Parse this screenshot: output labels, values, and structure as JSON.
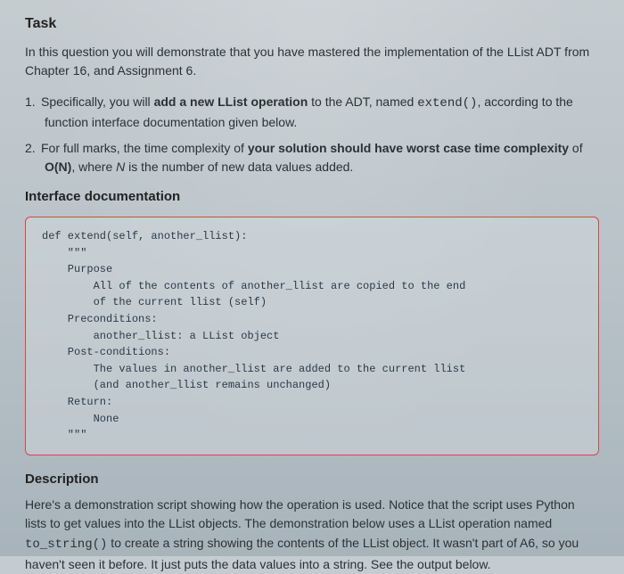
{
  "task_heading": "Task",
  "intro": "In this question you will demonstrate that you have mastered the implementation of the LList ADT from Chapter 16, and Assignment 6.",
  "list": {
    "item1": {
      "num": "1.",
      "pre": "Specifically, you will ",
      "bold": "add a new LList operation",
      "mid": " to the ADT, named ",
      "code": "extend()",
      "post": ", according to the function interface documentation given below."
    },
    "item2": {
      "num": "2.",
      "pre": "For full marks, the time complexity of ",
      "bold": "your solution should have worst case time complexity",
      "mid": " of ",
      "on": "O(N)",
      "post": ", where ",
      "nvar": "N",
      "tail": " is the number of new data values added."
    }
  },
  "interface_heading": "Interface documentation",
  "code": {
    "l1": "def extend(self, another_llist):",
    "l2": "    \"\"\"",
    "l3": "    Purpose",
    "l4": "        All of the contents of another_llist are copied to the end",
    "l5": "        of the current llist (self)",
    "l6": "    Preconditions:",
    "l7": "        another_llist: a LList object",
    "l8": "    Post-conditions:",
    "l9": "        The values in another_llist are added to the current llist",
    "l10": "        (and another_llist remains unchanged)",
    "l11": "    Return:",
    "l12": "        None",
    "l13": "    \"\"\""
  },
  "desc_heading": "Description",
  "desc": {
    "p1a": "Here's a demonstration script showing how the operation is used. Notice that the script uses Python lists to get values into the LList objects. The demonstration below uses a LList operation named ",
    "p1code": "to_string()",
    "p1b": " to create a string showing the contents of the LList object. It wasn't part of A6, so you haven't seen it before. It just puts the data values into a string. See the output below."
  }
}
